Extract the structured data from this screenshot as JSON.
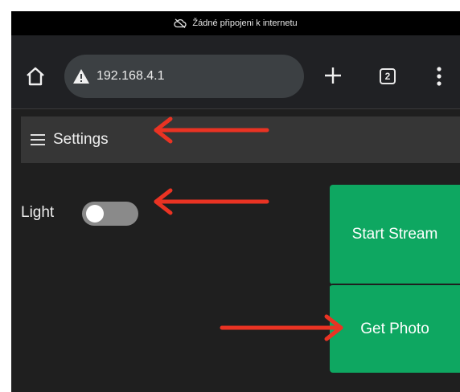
{
  "status_bar": {
    "message": "Žádné připojeni k internetu",
    "icon": "cloud-off-icon"
  },
  "browser": {
    "url": "192.168.4.1",
    "url_icon": "warning-icon",
    "tab_count": "2",
    "icons": [
      "home-icon",
      "plus-icon",
      "tabs-icon",
      "more-vert-icon"
    ]
  },
  "app": {
    "menu_label": "Settings",
    "menu_icon": "hamburger-icon",
    "light_label": "Light",
    "light_on": false,
    "start_stream_label": "Start Stream",
    "get_photo_label": "Get Photo"
  },
  "colors": {
    "background": "#1f1f1f",
    "button_green": "#0ea761",
    "annotation_red": "#ea3323"
  }
}
